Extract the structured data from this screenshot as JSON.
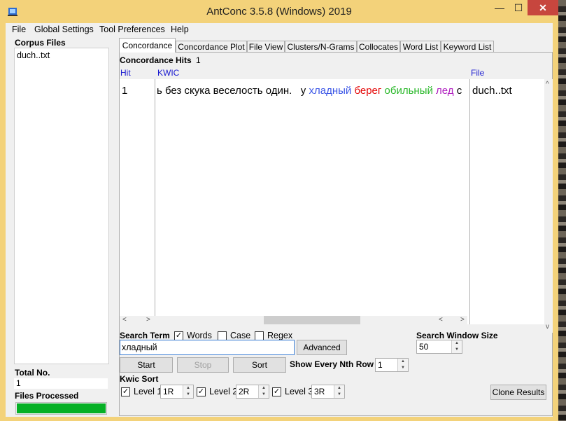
{
  "window": {
    "title": "AntConc 3.5.8 (Windows) 2019",
    "minimize": "—",
    "maximize": "☐",
    "close": "✕"
  },
  "menu": [
    "File",
    "Global Settings",
    "Tool Preferences",
    "Help"
  ],
  "corpus": {
    "title": "Corpus Files",
    "files": [
      "duch..txt"
    ],
    "total_label": "Total No.",
    "total_value": "1",
    "processed_label": "Files Processed",
    "progress": 1.0
  },
  "tabs": [
    "Concordance",
    "Concordance Plot",
    "File View",
    "Clusters/N-Grams",
    "Collocates",
    "Word List",
    "Keyword List"
  ],
  "concordance": {
    "hits_label": "Concordance Hits",
    "hits_count": "1",
    "col_hit": "Hit",
    "col_kwic": "KWIC",
    "col_file": "File",
    "row": {
      "hit": "1",
      "left": "ь без скука веселость один.   у ",
      "w1": "хладный",
      "w2": "берег",
      "w3": "обильный",
      "w4": "лед",
      "tail": "с",
      "file": "duch..txt"
    }
  },
  "search": {
    "label": "Search Term",
    "words": "Words",
    "case": "Case",
    "regex": "Regex",
    "value": "хладный",
    "advanced": "Advanced",
    "start": "Start",
    "stop": "Stop",
    "sort": "Sort",
    "window_label": "Search Window Size",
    "window_value": "50",
    "nth_label": "Show Every Nth Row",
    "nth_value": "1"
  },
  "kwic_sort": {
    "label": "Kwic Sort",
    "level1": "Level 1",
    "level1_value": "1R",
    "level2": "Level 2",
    "level2_value": "2R",
    "level3": "Level 3",
    "level3_value": "3R",
    "clone": "Clone Results"
  },
  "colors": {
    "title_bar": "#f3d27a",
    "close_button": "#c7463e",
    "progress": "#06b025",
    "kwic_w1": "#3a55e6",
    "kwic_w2": "#e40808",
    "kwic_w3": "#2ab82a",
    "kwic_w4": "#b020c0",
    "header_text": "#1a1ad0"
  }
}
